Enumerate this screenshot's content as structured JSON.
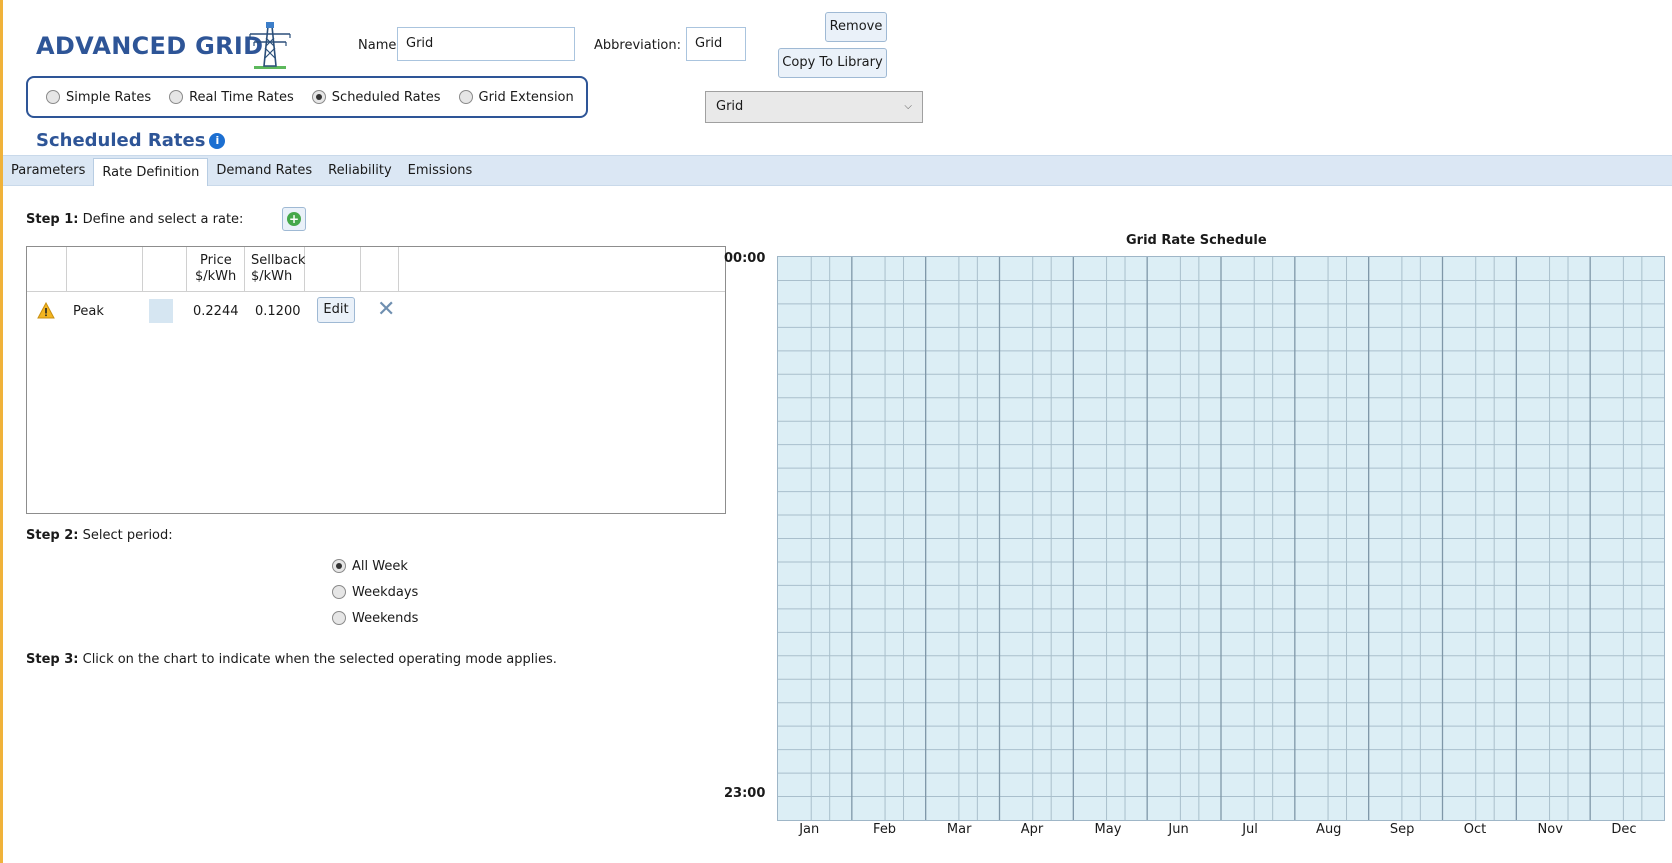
{
  "header": {
    "title": "ADVANCED GRID",
    "name_label": "Name:",
    "name_value": "Grid",
    "abbreviation_label": "Abbreviation:",
    "abbreviation_value": "Grid",
    "remove_label": "Remove",
    "copy_label": "Copy To Library",
    "library_select_value": "Grid"
  },
  "rate_types": [
    {
      "label": "Simple Rates",
      "selected": false
    },
    {
      "label": "Real Time Rates",
      "selected": false
    },
    {
      "label": "Scheduled Rates",
      "selected": true
    },
    {
      "label": "Grid Extension",
      "selected": false
    }
  ],
  "section_title": "Scheduled Rates",
  "tabs": [
    {
      "label": "Parameters",
      "active": false
    },
    {
      "label": "Rate Definition",
      "active": true
    },
    {
      "label": "Demand Rates",
      "active": false
    },
    {
      "label": "Reliability",
      "active": false
    },
    {
      "label": "Emissions",
      "active": false
    }
  ],
  "step1": {
    "bold": "Step 1:",
    "text": " Define and select a rate:"
  },
  "rate_table": {
    "headers": {
      "price_1": "Price",
      "price_2": "$/kWh",
      "sellback_1": "Sellback",
      "sellback_2": "$/kWh"
    },
    "rows": [
      {
        "name": "Peak",
        "price": "0.2244",
        "sellback": "0.1200",
        "edit": "Edit"
      }
    ]
  },
  "step2": {
    "bold": "Step 2:",
    "text": " Select period:"
  },
  "periods": [
    {
      "label": "All Week",
      "selected": true
    },
    {
      "label": "Weekdays",
      "selected": false
    },
    {
      "label": "Weekends",
      "selected": false
    }
  ],
  "step3": {
    "bold": "Step 3:",
    "text": " Click on the chart to indicate when the selected operating mode applies."
  },
  "schedule": {
    "title": "Grid Rate Schedule",
    "y_top": "00:00",
    "y_bottom": "23:00",
    "months": [
      "Jan",
      "Feb",
      "Mar",
      "Apr",
      "May",
      "Jun",
      "Jul",
      "Aug",
      "Sep",
      "Oct",
      "Nov",
      "Dec"
    ],
    "cell_color": "#dceef5"
  }
}
